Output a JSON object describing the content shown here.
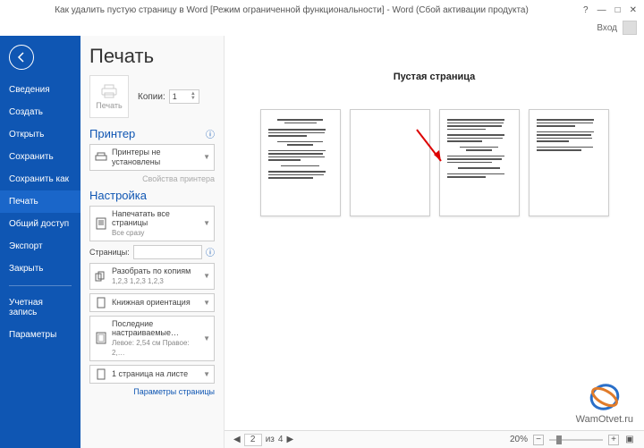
{
  "titlebar": {
    "title": "Как удалить пустую страницу в Word [Режим ограниченной функциональности] - Word (Сбой активации продукта)",
    "help": "?",
    "min": "—",
    "max": "□",
    "close": "✕",
    "login": "Вход"
  },
  "sidebar": {
    "items": [
      {
        "label": "Сведения"
      },
      {
        "label": "Создать"
      },
      {
        "label": "Открыть"
      },
      {
        "label": "Сохранить"
      },
      {
        "label": "Сохранить как"
      },
      {
        "label": "Печать"
      },
      {
        "label": "Общий доступ"
      },
      {
        "label": "Экспорт"
      },
      {
        "label": "Закрыть"
      }
    ],
    "items2": [
      {
        "label": "Учетная запись"
      },
      {
        "label": "Параметры"
      }
    ]
  },
  "print": {
    "heading": "Печать",
    "button": "Печать",
    "copies_label": "Копии:",
    "copies_value": "1",
    "printer_heading": "Принтер",
    "printer_combo": "Принтеры не установлены",
    "printer_props": "Свойства принтера",
    "settings_heading": "Настройка",
    "scope": {
      "main": "Напечатать все страницы",
      "sub": "Все сразу"
    },
    "pages_label": "Страницы:",
    "collate": {
      "main": "Разобрать по копиям",
      "sub": "1,2,3   1,2,3   1,2,3"
    },
    "orient": "Книжная ориентация",
    "margins": {
      "main": "Последние настраиваемые…",
      "sub": "Левое: 2,54 см  Правое: 2,…"
    },
    "perpage": "1 страница на листе",
    "page_setup": "Параметры страницы"
  },
  "preview": {
    "annotation": "Пустая страница",
    "logo": "WamOtvet.ru"
  },
  "status": {
    "page_current": "2",
    "page_sep": "из",
    "page_total": "4",
    "zoom": "20%"
  }
}
